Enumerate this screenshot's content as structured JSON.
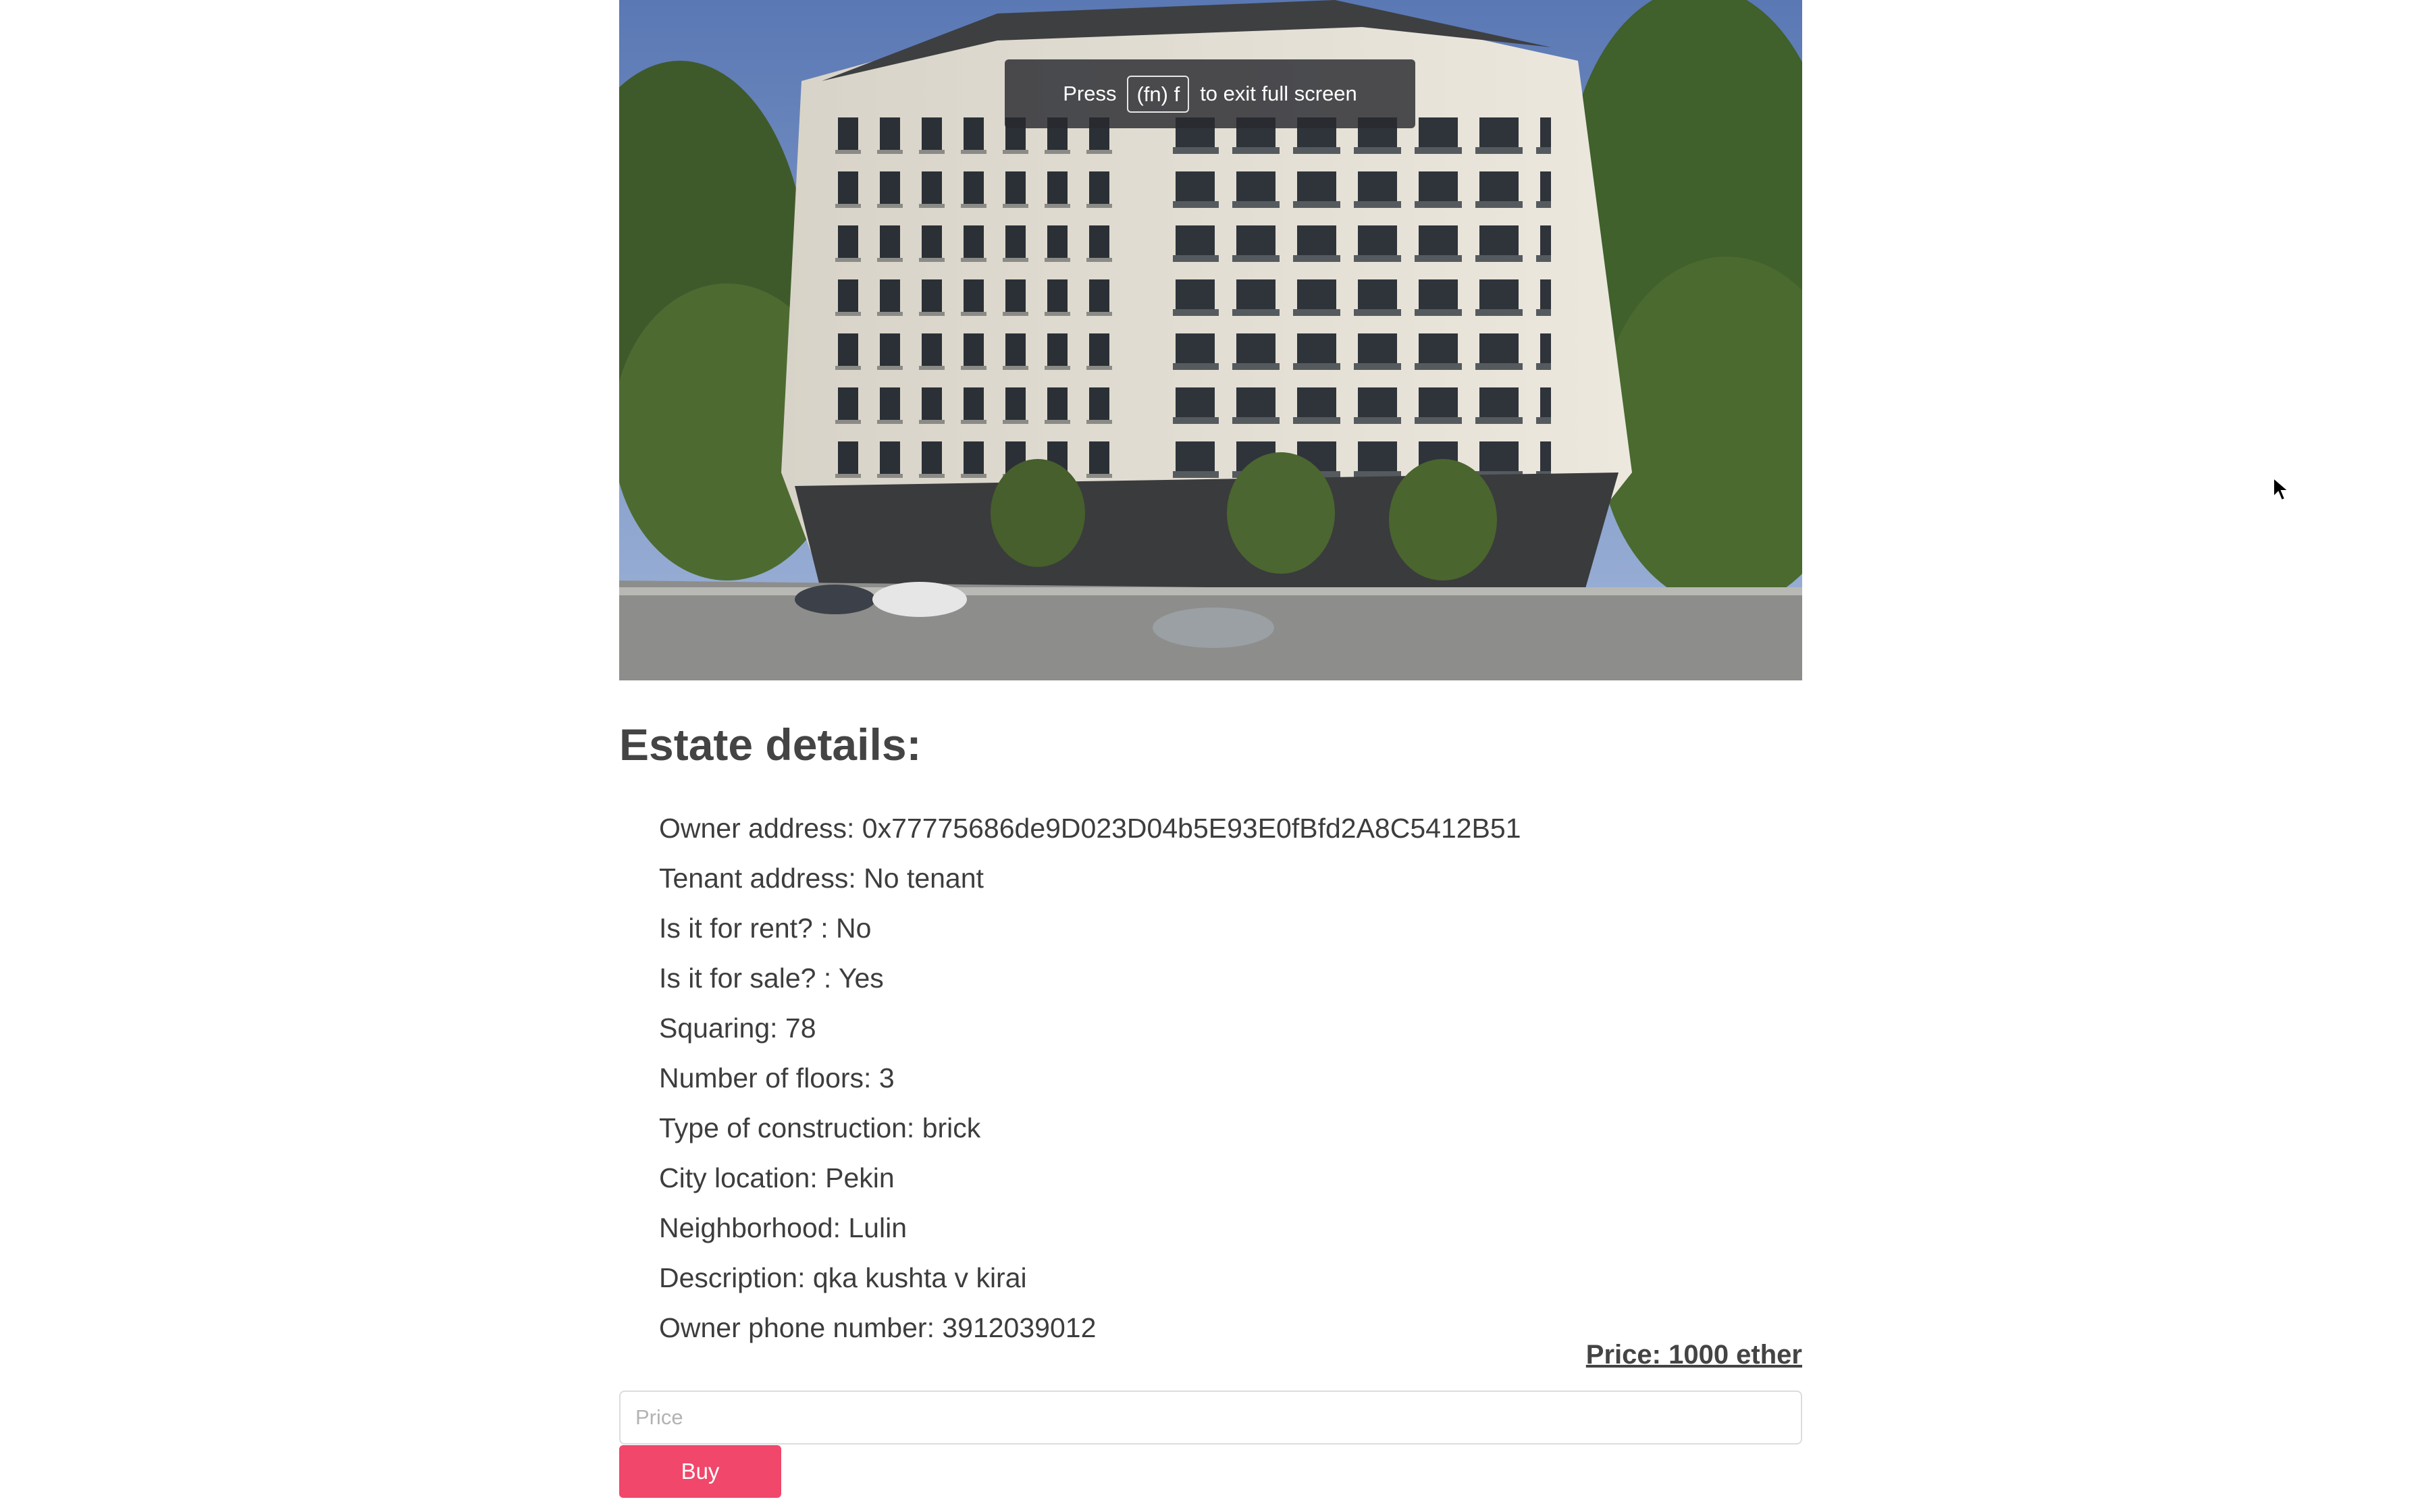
{
  "hero_image": {
    "alt": "Apartment building",
    "icon": "building-photo"
  },
  "fullscreen_notice": {
    "press": "Press",
    "key": "(fn) f",
    "suffix": "to exit full screen"
  },
  "details": {
    "title": "Estate details:",
    "items": [
      "Owner address: 0x77775686de9D023D04b5E93E0fBfd2A8C5412B51",
      "Tenant address: No tenant",
      "Is it for rent? : No",
      "Is it for sale? : Yes",
      "Squaring: 78",
      "Number of floors: 3",
      "Type of construction: brick",
      "City location: Pekin",
      "Neighborhood: Lulin",
      "Description: qka kushta v kirai",
      "Owner phone number: 3912039012"
    ]
  },
  "price": {
    "label": "Price: 1000 ether",
    "input_placeholder": "Price",
    "input_value": ""
  },
  "buy_button": {
    "label": "Buy",
    "color": "#f0476a"
  }
}
